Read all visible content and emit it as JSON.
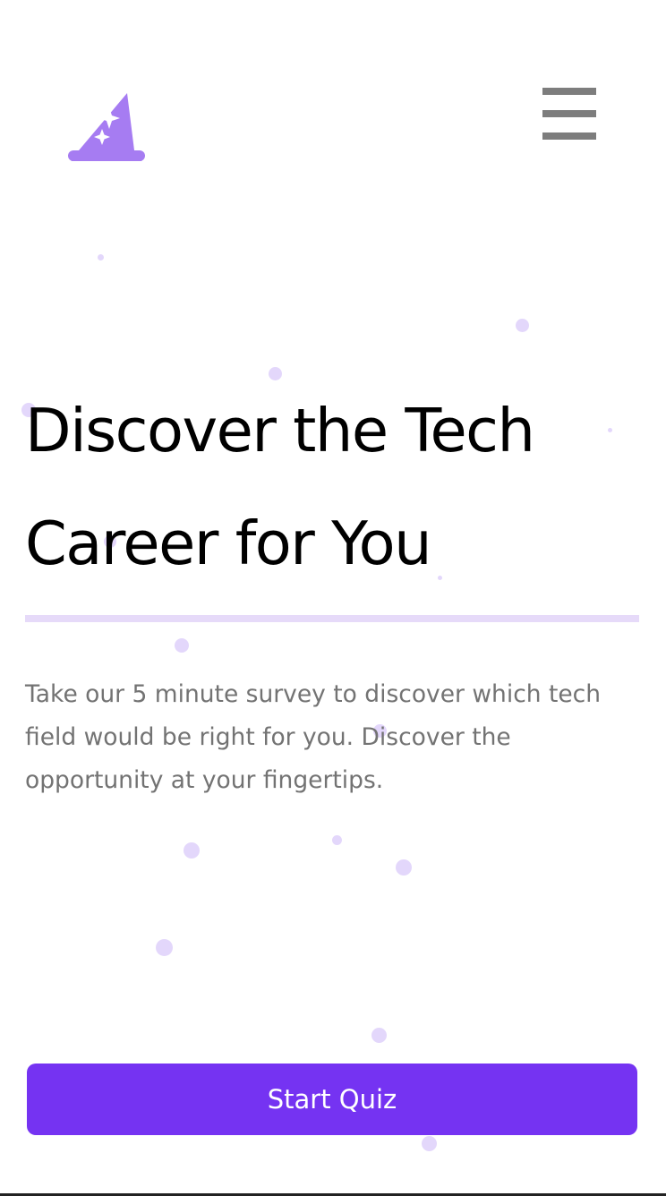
{
  "header": {
    "logo_icon": "wizard-hat-icon",
    "menu_icon": "hamburger-menu-icon"
  },
  "hero": {
    "title_line1": "Discover the Tech",
    "title_line2": "Career for You",
    "description": "Take our 5 minute survey to discover which tech field would be right for you. Discover the opportunity at your fingertips."
  },
  "cta": {
    "label": "Start Quiz"
  },
  "colors": {
    "accent": "#7533f2",
    "logo": "#a67cf2",
    "dot": "#e3d7fb",
    "rule": "#e6daf9",
    "menu": "#7d7d7d",
    "body_text": "#737373"
  }
}
